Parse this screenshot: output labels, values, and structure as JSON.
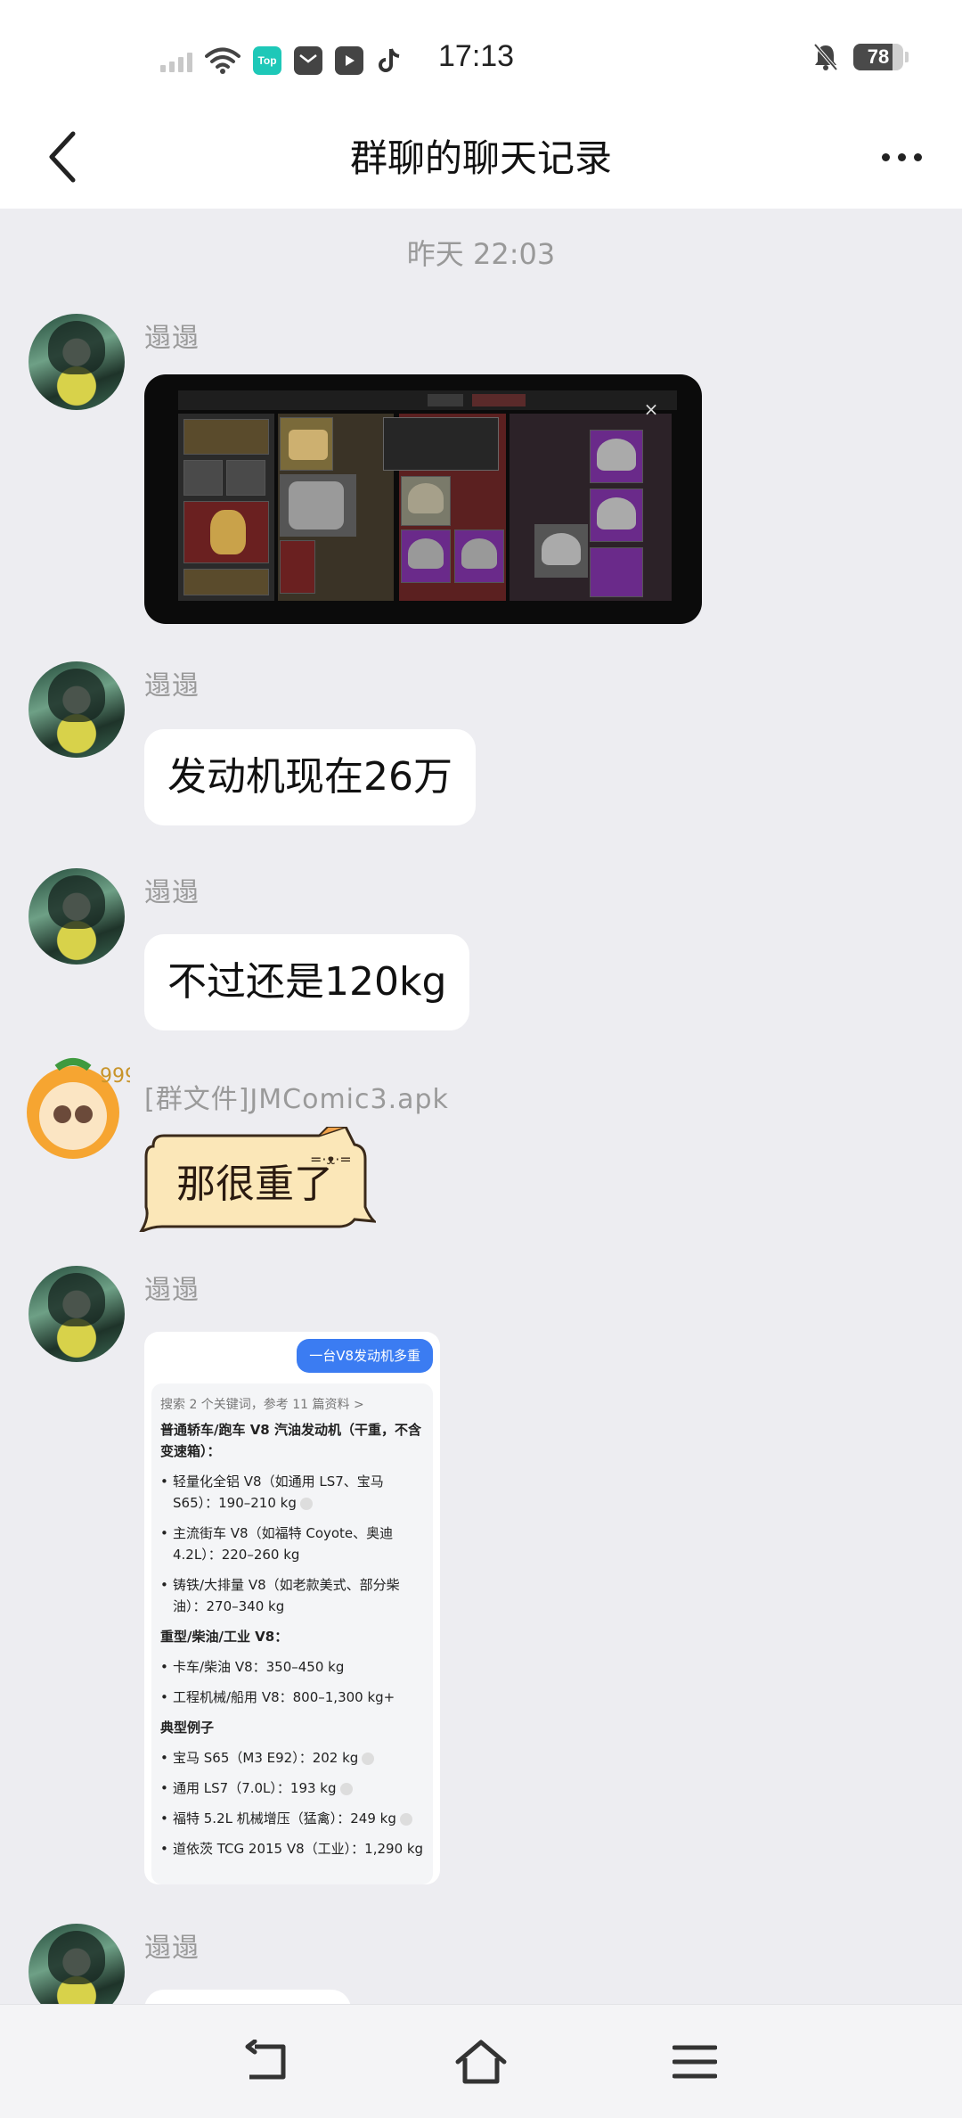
{
  "status_bar": {
    "time": "17:13",
    "battery_level": "78",
    "battery_fraction": 0.78,
    "icons": [
      "signal-icon",
      "wifi-icon",
      "top-app-icon",
      "mail-app-icon",
      "video-app-icon",
      "tiktok-icon",
      "mute-bell-icon",
      "battery-icon"
    ],
    "top_app_label": "Top"
  },
  "header": {
    "title": "群聊的聊天记录",
    "back_icon": "chevron-left-icon",
    "more_icon": "more-dots-icon"
  },
  "chat": {
    "timestamp": "昨天 22:03",
    "messages": [
      {
        "sender": "遢遢",
        "type": "image",
        "description": "game-inventory-screenshot"
      },
      {
        "sender": "遢遢",
        "type": "text",
        "text": "发动机现在26万"
      },
      {
        "sender": "遢遢",
        "type": "text",
        "text": "不过还是120kg"
      },
      {
        "sender": "[群文件]JMComic3.apk",
        "type": "sticker-text",
        "text": "那很重了"
      },
      {
        "sender": "遢遢",
        "type": "image-screenshot",
        "query": "一台V8发动机多重",
        "search_note": "搜索 2 个关键词，参考 11 篇资料 >",
        "lines": [
          "普通轿车/跑车 V8 汽油发动机（干重，不含变速箱）：",
          "轻量化全铝 V8（如通用 LS7、宝马 S65）：190–210 kg",
          "主流街车 V8（如福特 Coyote、奥迪 4.2L）：220–260 kg",
          "铸铁/大排量 V8（如老款美式、部分柴油）：270–340 kg",
          "重型/柴油/工业 V8：",
          "卡车/柴油 V8：350–450 kg",
          "工程机械/船用 V8：800–1,300 kg+",
          "典型例子",
          "宝马 S65（M3 E92）：202 kg",
          "通用 LS7（7.0L）：193 kg",
          "福特 5.2L 机械增压（猛禽）：249 kg",
          "道依茨 TCG 2015 V8（工业）：1,290 kg"
        ]
      },
      {
        "sender": "遢遢",
        "type": "text",
        "text": ""
      }
    ]
  },
  "nav_bar": {
    "icons": [
      "back-nav-icon",
      "home-nav-icon",
      "menu-nav-icon"
    ]
  }
}
